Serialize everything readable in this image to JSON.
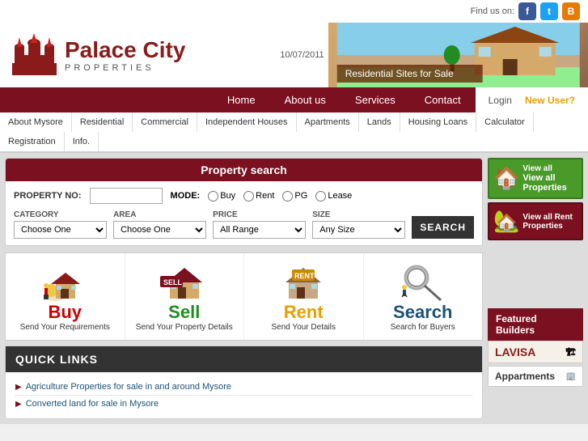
{
  "header": {
    "find_us": "Find us on:",
    "logo_name": "Palace City",
    "logo_sub": "PROPERTIES",
    "date": "10/07/2011",
    "social": [
      "f",
      "t",
      "B"
    ]
  },
  "nav": {
    "items": [
      {
        "label": "Home"
      },
      {
        "label": "About us"
      },
      {
        "label": "Services"
      },
      {
        "label": "Contact"
      }
    ],
    "login": "Login",
    "new_user": "New User?"
  },
  "sub_nav": {
    "items": [
      "About Mysore",
      "Residential",
      "Commercial",
      "Independent Houses",
      "Apartments",
      "Lands",
      "Housing Loans",
      "Calculator",
      "Registration",
      "Info."
    ]
  },
  "property_search": {
    "title": "Property search",
    "property_no_label": "PROPERTY NO:",
    "mode_label": "MODE:",
    "modes": [
      "Buy",
      "Rent",
      "PG",
      "Lease"
    ],
    "fields": [
      {
        "label": "CATEGORY",
        "options": [
          "Choose One"
        ]
      },
      {
        "label": "AREA",
        "options": [
          "Choose One"
        ]
      },
      {
        "label": "PRICE",
        "options": [
          "All Range"
        ]
      },
      {
        "label": "SIZE",
        "options": [
          "Any Size"
        ]
      }
    ],
    "search_btn": "SEARCH"
  },
  "action_cards": [
    {
      "icon": "🏠",
      "title": "Buy",
      "subtitle": "Send Your Requirements",
      "color": "buy"
    },
    {
      "icon": "🏡",
      "title": "Sell",
      "subtitle": "Send Your Property Details",
      "color": "sell"
    },
    {
      "icon": "🏘",
      "title": "Rent",
      "subtitle": "Send Your Details",
      "color": "rent"
    },
    {
      "icon": "🔍",
      "title": "Search",
      "subtitle": "Search for Buyers",
      "color": "search"
    }
  ],
  "quick_links": {
    "title": "QUICK LINKS",
    "items": [
      "Agriculture Properties for sale in and around Mysore",
      "Converted land for sale in Mysore"
    ]
  },
  "right_panel": {
    "view_all": "View all Properties",
    "view_rent": "View all Rent Properties",
    "house_icon": "🏠"
  },
  "featured": {
    "title": "Featured Builders",
    "items": [
      "LAVISA",
      "Appartments"
    ]
  },
  "banner": {
    "text": "Residential Sites for Sale"
  }
}
